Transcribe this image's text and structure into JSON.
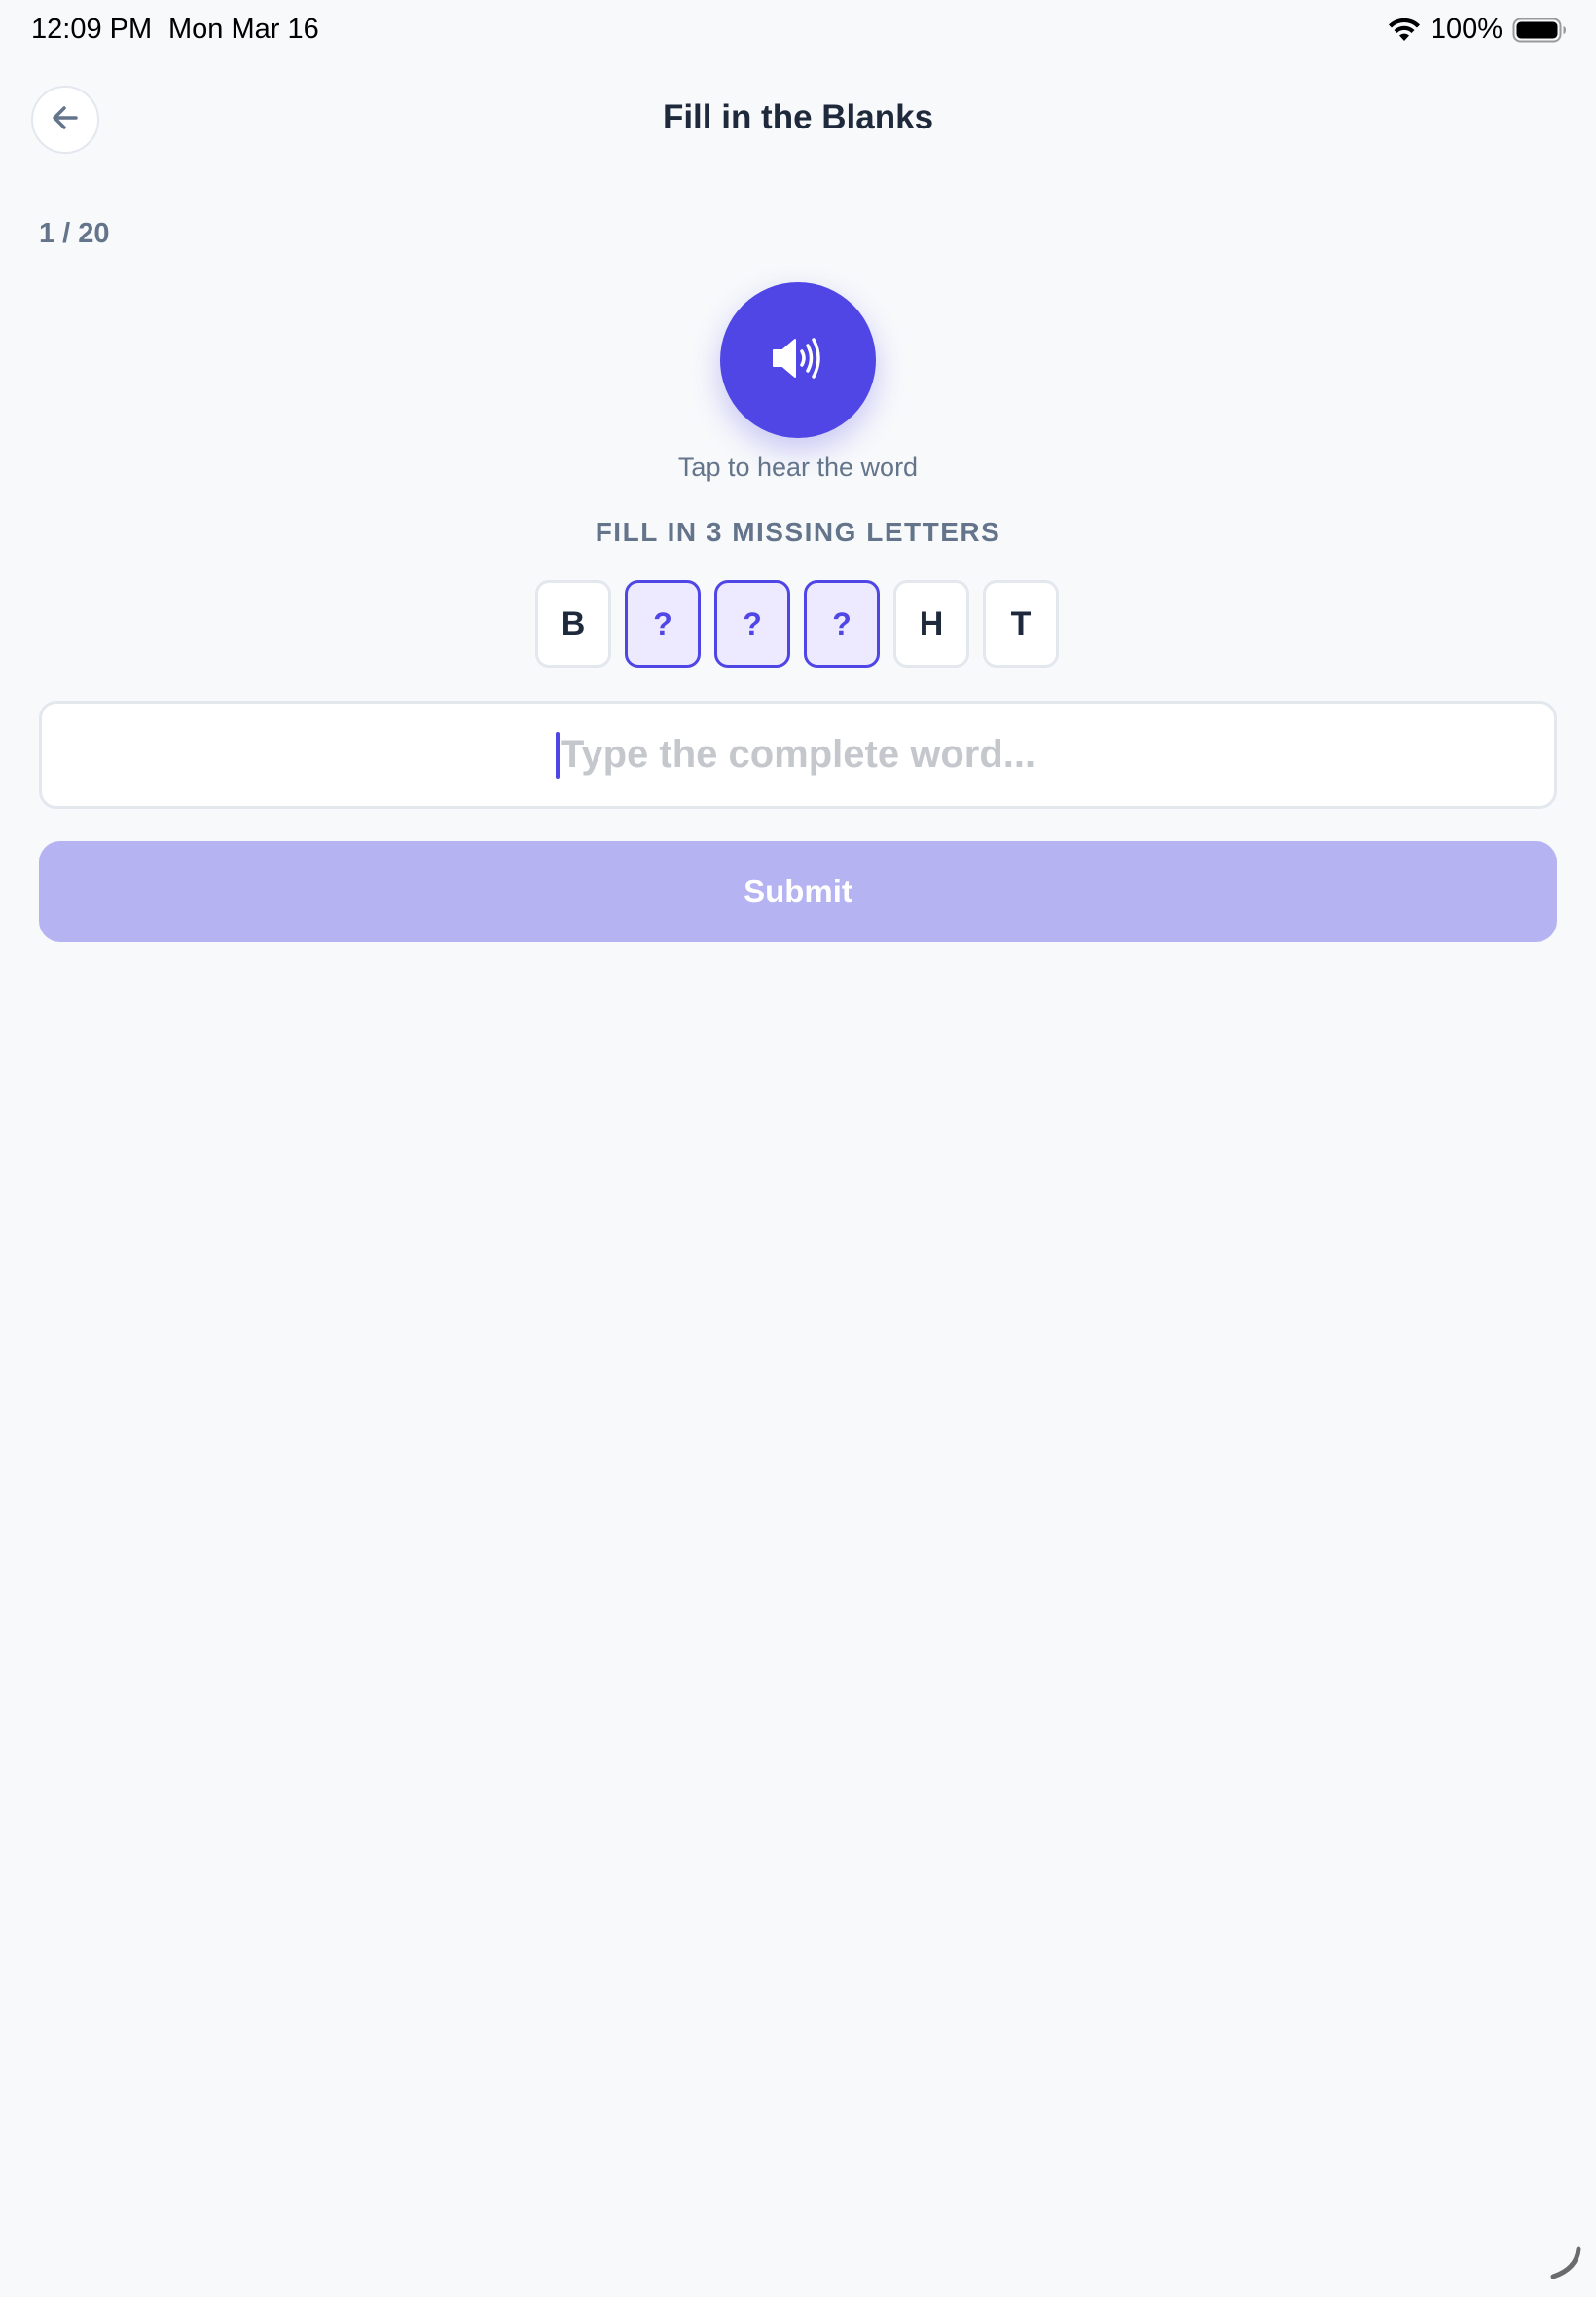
{
  "status_bar": {
    "time": "12:09 PM",
    "date": "Mon Mar 16",
    "battery": "100%",
    "icons": [
      "wifi-icon",
      "battery-icon"
    ]
  },
  "header": {
    "back_icon": "arrow-left-icon",
    "title": "Fill in the Blanks"
  },
  "progress": "1 / 20",
  "audio": {
    "icon": "speaker-icon",
    "hint": "Tap to hear the word"
  },
  "instruction": "FILL IN 3 MISSING LETTERS",
  "tiles": [
    "B",
    "?",
    "?",
    "?",
    "H",
    "T"
  ],
  "input": {
    "value": "",
    "placeholder": "Type the complete word..."
  },
  "submit_label": "Submit",
  "colors": {
    "accent": "#4f46e5",
    "accent_light": "#ede9fe",
    "submit_disabled": "#b6b3f2",
    "background": "#f7f9fb"
  }
}
